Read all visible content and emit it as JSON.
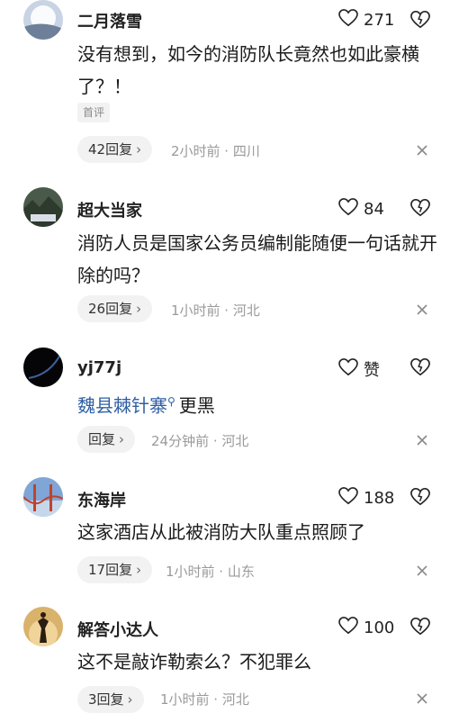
{
  "comments": [
    {
      "username": "二月落雪",
      "likes": "271",
      "content": "没有想到，如今的消防队长竟然也如此豪横了？！",
      "tag": "首评",
      "replies": "42回复",
      "meta": "2小时前 · 四川"
    },
    {
      "username": "超大当家",
      "likes": "84",
      "content": "消防人员是国家公务员编制能随便一句话就开除的吗？",
      "replies": "26回复",
      "meta": "1小时前 · 河北"
    },
    {
      "username": "yj77j",
      "likes": "赞",
      "mention": "魏县棘针寨",
      "content": "更黑",
      "replies": "回复",
      "meta": "24分钟前 · 河北"
    },
    {
      "username": "东海岸",
      "likes": "188",
      "content": "这家酒店从此被消防大队重点照顾了",
      "replies": "17回复",
      "meta": "1小时前 · 山东"
    },
    {
      "username": "解答小达人",
      "likes": "100",
      "content": "这不是敲诈勒索么？不犯罪么",
      "replies": "3回复",
      "meta": "1小时前 · 河北"
    }
  ],
  "icons": {
    "like": "heart-outline-icon",
    "dislike": "broken-heart-icon",
    "close": "close-icon",
    "reply_chevron": "chevron-right-icon",
    "mention": "search-icon"
  },
  "colors": {
    "mention": "#2f5fa3",
    "meta": "#9a9a9a",
    "pill_bg": "#f2f2f2"
  }
}
